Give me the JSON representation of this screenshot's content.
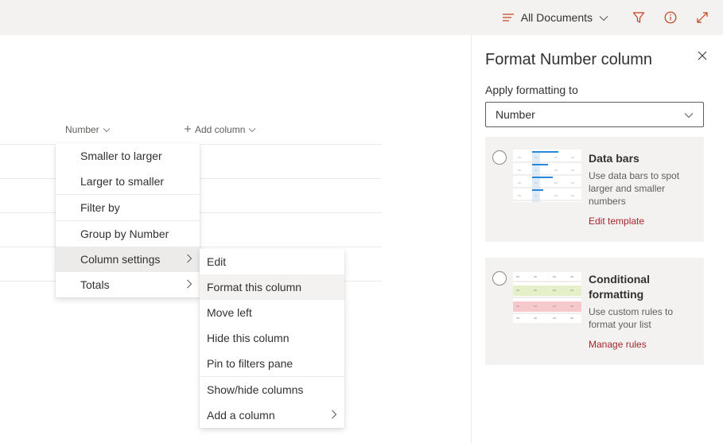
{
  "topbar": {
    "view_label": "All Documents",
    "icons": [
      "lines-icon",
      "chevron-down-icon",
      "filter-icon",
      "info-icon",
      "expand-icon"
    ]
  },
  "list": {
    "columns": [
      {
        "label": "Number",
        "icon": "chevron-down-icon"
      },
      {
        "label": "Add column",
        "icon": "plus-icon"
      }
    ]
  },
  "context_menu": {
    "items": [
      {
        "label": "Smaller to larger"
      },
      {
        "label": "Larger to smaller"
      },
      {
        "label": "Filter by"
      },
      {
        "label": "Group by Number"
      },
      {
        "label": "Column settings",
        "submenu": true,
        "active": true
      },
      {
        "label": "Totals",
        "submenu": true
      }
    ]
  },
  "sub_menu": {
    "items": [
      {
        "label": "Edit"
      },
      {
        "label": "Format this column",
        "hover": true
      },
      {
        "label": "Move left"
      },
      {
        "label": "Hide this column"
      },
      {
        "label": "Pin to filters pane"
      },
      {
        "label": "Show/hide columns"
      },
      {
        "label": "Add a column",
        "submenu": true
      }
    ]
  },
  "panel": {
    "title": "Format Number column",
    "apply_label": "Apply formatting to",
    "dropdown_value": "Number",
    "cards": [
      {
        "title": "Data bars",
        "description": "Use data bars to spot larger and smaller numbers",
        "link": "Edit template"
      },
      {
        "title": "Conditional formatting",
        "description": "Use custom rules to format your list",
        "link": "Manage rules"
      }
    ]
  },
  "colors": {
    "accent_link": "#a4262c",
    "icon_red": "#c43e1c",
    "bar_blue": "#2b88d8",
    "light_blue": "#deecf9",
    "green_band": "#e6f0c8",
    "red_band": "#f6c9cc"
  }
}
